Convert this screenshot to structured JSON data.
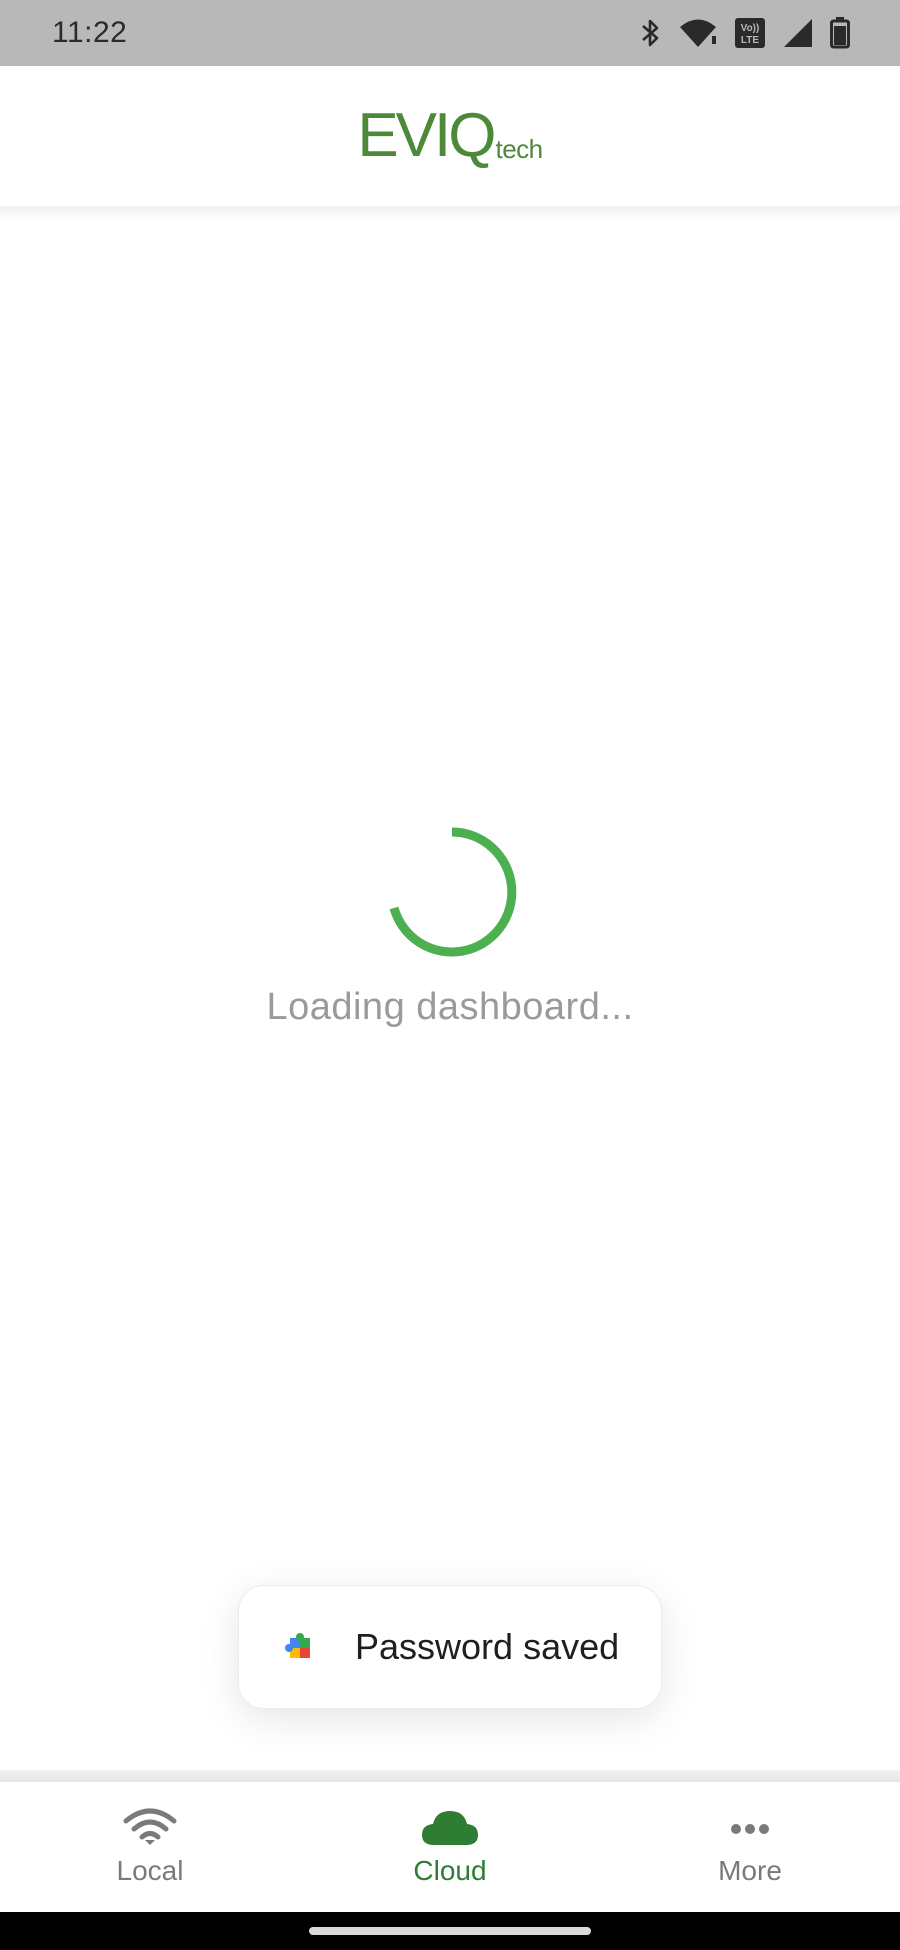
{
  "status_bar": {
    "time": "11:22",
    "icons": [
      "bluetooth-icon",
      "wifi-icon",
      "volte-icon",
      "signal-icon",
      "battery-icon"
    ],
    "volte_top": "Vo))",
    "volte_bottom": "LTE"
  },
  "header": {
    "logo_main": "EVIQ",
    "logo_suffix": "tech"
  },
  "main": {
    "loading_text": "Loading dashboard..."
  },
  "toast": {
    "icon": "puzzle-icon",
    "message": "Password saved"
  },
  "bottom_nav": {
    "items": [
      {
        "label": "Local",
        "icon": "wifi-icon",
        "active": false
      },
      {
        "label": "Cloud",
        "icon": "cloud-icon",
        "active": true
      },
      {
        "label": "More",
        "icon": "more-horizontal-icon",
        "active": false
      }
    ]
  },
  "colors": {
    "brand": "#4c8a3a",
    "spinner": "#4caf50",
    "active_nav": "#2e7d32",
    "inactive_nav": "#7a7a7a",
    "status_bar_bg": "#b8b8b8"
  }
}
